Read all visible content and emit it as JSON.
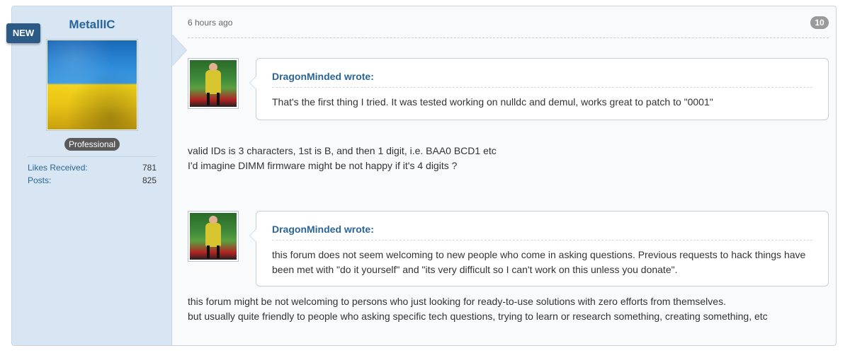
{
  "author": {
    "username": "MetallIC",
    "new_badge": "NEW",
    "rank": "Professional",
    "stats": [
      {
        "label": "Likes Received:",
        "value": "781"
      },
      {
        "label": "Posts:",
        "value": "825"
      }
    ]
  },
  "post": {
    "time": "6 hours ago",
    "number": "10",
    "blocks": [
      {
        "quote_author": "DragonMinded wrote:",
        "quote_text": "That's the first thing I tried. It was tested working on nulldc and demul, works great to patch to \"0001\"",
        "reply_lines": [
          "valid IDs is 3 characters, 1st is B, and then 1 digit, i.e. BAA0 BCD1 etc",
          "I'd imagine DIMM firmware might be not happy if it's 4 digits ?"
        ]
      },
      {
        "quote_author": "DragonMinded wrote:",
        "quote_text": "this forum does not seem welcoming to new people who come in asking questions. Previous requests to hack things have been met with \"do it yourself\" and \"its very difficult so I can't work on this unless you donate\".",
        "reply_lines": [
          "this forum might be not welcoming to persons who just looking for ready-to-use solutions with zero efforts from themselves.",
          "but usually quite friendly to people who asking specific tech questions, trying to learn or research something, creating something, etc"
        ]
      }
    ]
  }
}
